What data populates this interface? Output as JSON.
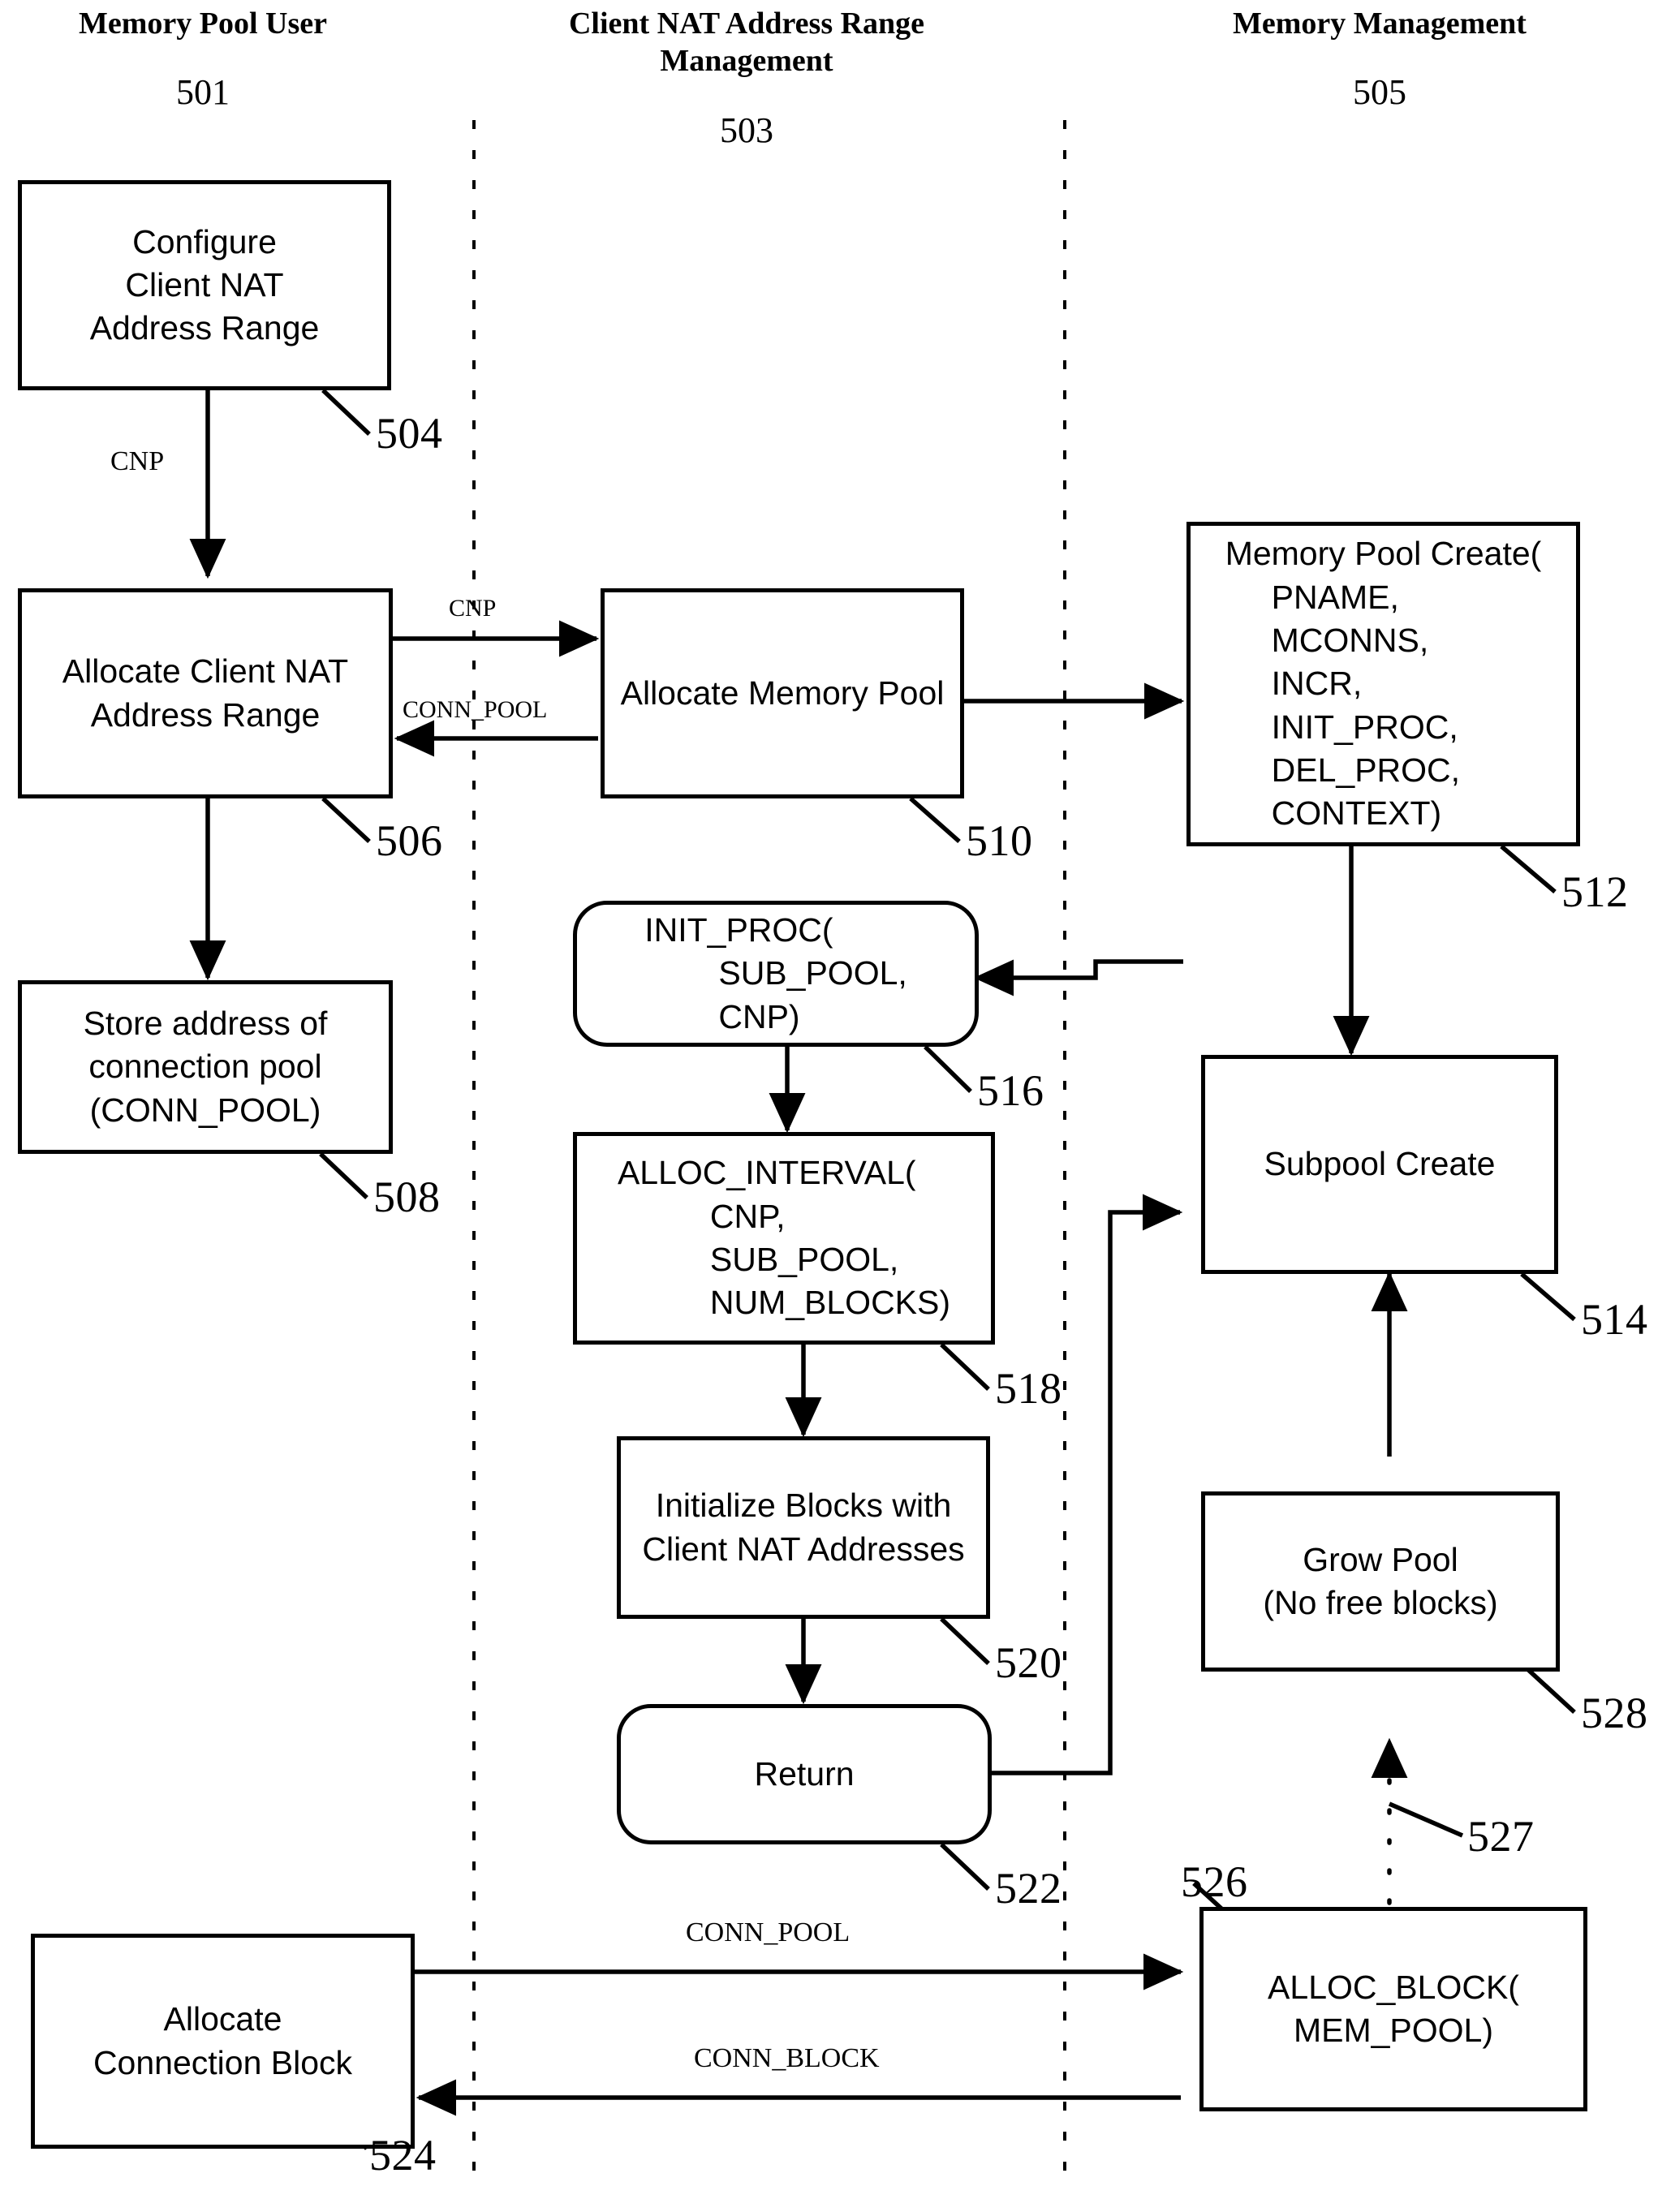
{
  "figure": {
    "type": "swimlane-flowchart",
    "lanes": [
      {
        "title": "Memory Pool User",
        "number": "501"
      },
      {
        "title": "Client NAT Address Range\nManagement",
        "number": "503"
      },
      {
        "title": "Memory Management",
        "number": "505"
      }
    ]
  },
  "nodes": {
    "n504": {
      "label": "Configure\nClient NAT\nAddress Range",
      "ref": "504",
      "shape": "rect",
      "lane": "Memory Pool User"
    },
    "n506": {
      "label": "Allocate Client NAT\nAddress Range",
      "ref": "506",
      "shape": "rect",
      "lane": "Memory Pool User"
    },
    "n508": {
      "label": "Store address of\nconnection pool\n(CONN_POOL)",
      "ref": "508",
      "shape": "rect",
      "lane": "Memory Pool User"
    },
    "n510": {
      "label": "Allocate Memory Pool",
      "ref": "510",
      "shape": "rect",
      "lane": "Client NAT Address Range Management"
    },
    "n516": {
      "label": "INIT_PROC(\n        SUB_POOL,\n        CNP)",
      "ref": "516",
      "shape": "rounded-rect",
      "lane": "Client NAT Address Range Management"
    },
    "n518": {
      "label": "ALLOC_INTERVAL(\n          CNP,\n          SUB_POOL,\n          NUM_BLOCKS)",
      "ref": "518",
      "shape": "rect",
      "lane": "Client NAT Address Range Management"
    },
    "n520": {
      "label": "Initialize Blocks with\nClient NAT Addresses",
      "ref": "520",
      "shape": "rect",
      "lane": "Client NAT Address Range Management"
    },
    "n522": {
      "label": "Return",
      "ref": "522",
      "shape": "rounded-rect",
      "lane": "Client NAT Address Range Management"
    },
    "n524": {
      "label": "Allocate\nConnection Block",
      "ref": "524",
      "shape": "rect",
      "lane": "Memory Pool User"
    },
    "n512": {
      "label": "Memory Pool Create(\n     PNAME,\n     MCONNS,\n     INCR,\n     INIT_PROC,\n     DEL_PROC,\n     CONTEXT)",
      "ref": "512",
      "shape": "rect",
      "lane": "Memory Management"
    },
    "n514": {
      "label": "Subpool Create",
      "ref": "514",
      "shape": "rect",
      "lane": "Memory Management"
    },
    "n528": {
      "label": "Grow Pool\n(No free blocks)",
      "ref": "528",
      "shape": "rect",
      "lane": "Memory Management"
    },
    "n526": {
      "label": "ALLOC_BLOCK(\nMEM_POOL)",
      "ref": "526",
      "shape": "rect",
      "lane": "Memory Management"
    }
  },
  "dangling_refs": {
    "r527": "527"
  },
  "edge_labels": {
    "cnp_504_506": "CNP",
    "cnp_506_510": "CNP",
    "conn_pool_510_506": "CONN_POOL",
    "conn_pool_524_526": "CONN_POOL",
    "conn_block_526_524": "CONN_BLOCK"
  },
  "colors": {
    "stroke": "#000000",
    "background": "#ffffff"
  }
}
